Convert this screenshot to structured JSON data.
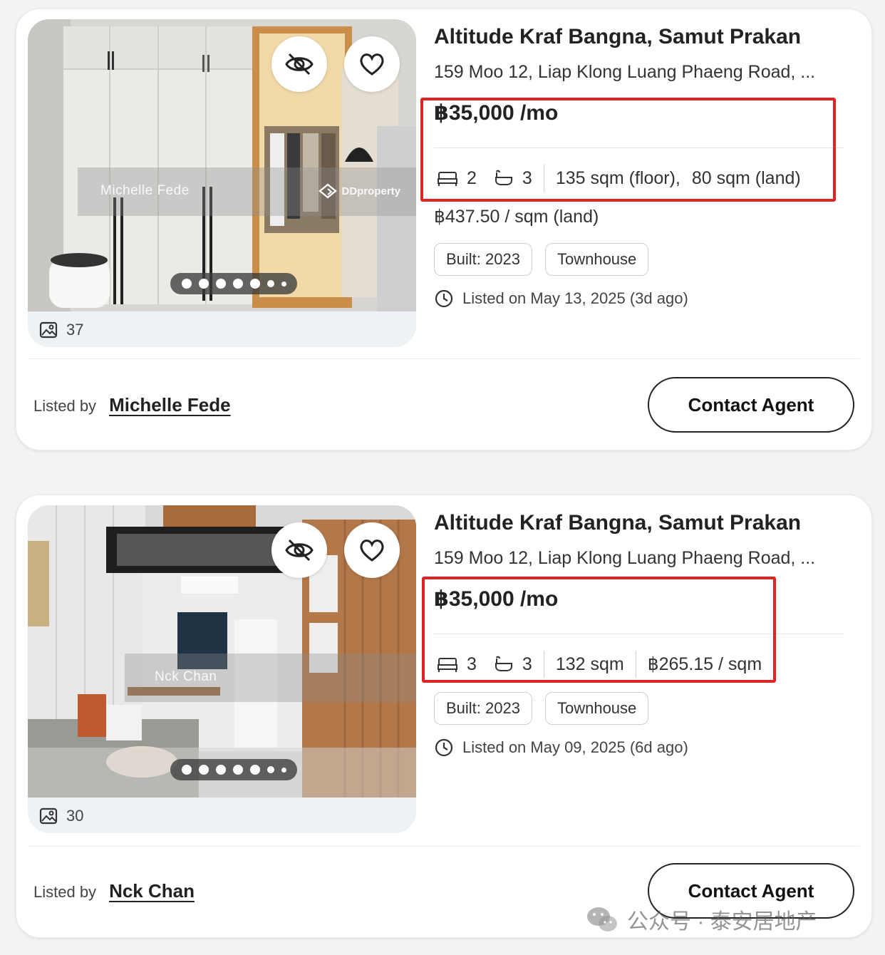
{
  "listings": [
    {
      "title": "Altitude Kraf Bangna, Samut Prakan",
      "address": "159 Moo 12, Liap Klong Luang Phaeng Road, ...",
      "price": "฿35,000 /mo",
      "beds": "2",
      "baths": "3",
      "area_floor": "135 sqm (floor),",
      "area_land": "80 sqm (land)",
      "price_per_sqm": "฿437.50 / sqm (land)",
      "tags": [
        "Built: 2023",
        "Townhouse"
      ],
      "listed_on": "Listed on May 13, 2025 (3d ago)",
      "photo_count": "37",
      "photo_watermark": "Michelle Fede",
      "photo_brand": "DDproperty",
      "listed_by_label": "Listed by",
      "agent_name": "Michelle Fede",
      "contact_label": "Contact Agent",
      "carousel_slides": 6,
      "carousel_active": 1
    },
    {
      "title": "Altitude Kraf Bangna, Samut Prakan",
      "address": "159 Moo 12, Liap Klong Luang Phaeng Road, ...",
      "price": "฿35,000 /mo",
      "beds": "3",
      "baths": "3",
      "area": "132 sqm",
      "price_per_sqm": "฿265.15 / sqm",
      "tags": [
        "Built: 2023",
        "Townhouse"
      ],
      "listed_on": "Listed on May 09, 2025 (6d ago)",
      "photo_count": "30",
      "photo_watermark": "Nck Chan",
      "listed_by_label": "Listed by",
      "agent_name": "Nck Chan",
      "contact_label": "Contact Agent",
      "carousel_slides": 6,
      "carousel_active": 1
    }
  ],
  "footer_watermark": "公众号 · 泰安居地产",
  "colors": {
    "highlight": "#e02424",
    "text": "#222222",
    "card_bg": "#ffffff",
    "page_bg": "#f3f3f5"
  },
  "icons": [
    "hide-listing-icon",
    "heart-icon",
    "photo-gallery-icon",
    "bed-icon",
    "bath-icon",
    "clock-icon",
    "wechat-icon",
    "ddproperty-logo-icon"
  ]
}
